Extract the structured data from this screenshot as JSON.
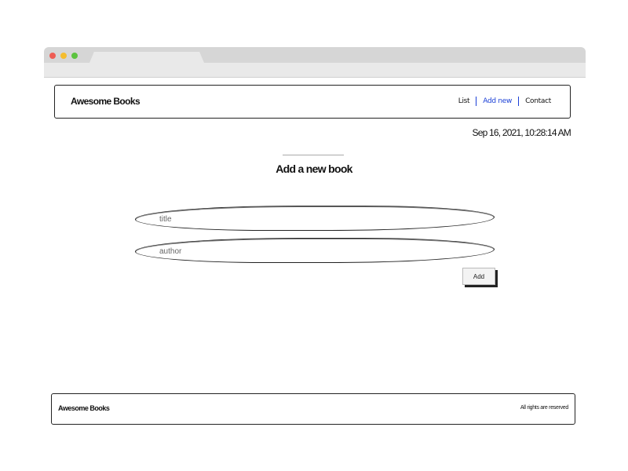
{
  "brand": "Awesome Books",
  "nav": {
    "list": "List",
    "add_new": "Add new",
    "contact": "Contact"
  },
  "datetime": "Sep 16, 2021, 10:28:14 AM",
  "section_title": "Add a new book",
  "form": {
    "title_placeholder": "title",
    "title_value": "",
    "author_placeholder": "author",
    "author_value": "",
    "add_label": "Add"
  },
  "footer": {
    "brand": "Awesome Books",
    "rights": "All rights are reserved"
  },
  "colors": {
    "nav_active": "#1a3fd6",
    "border": "#222222"
  }
}
